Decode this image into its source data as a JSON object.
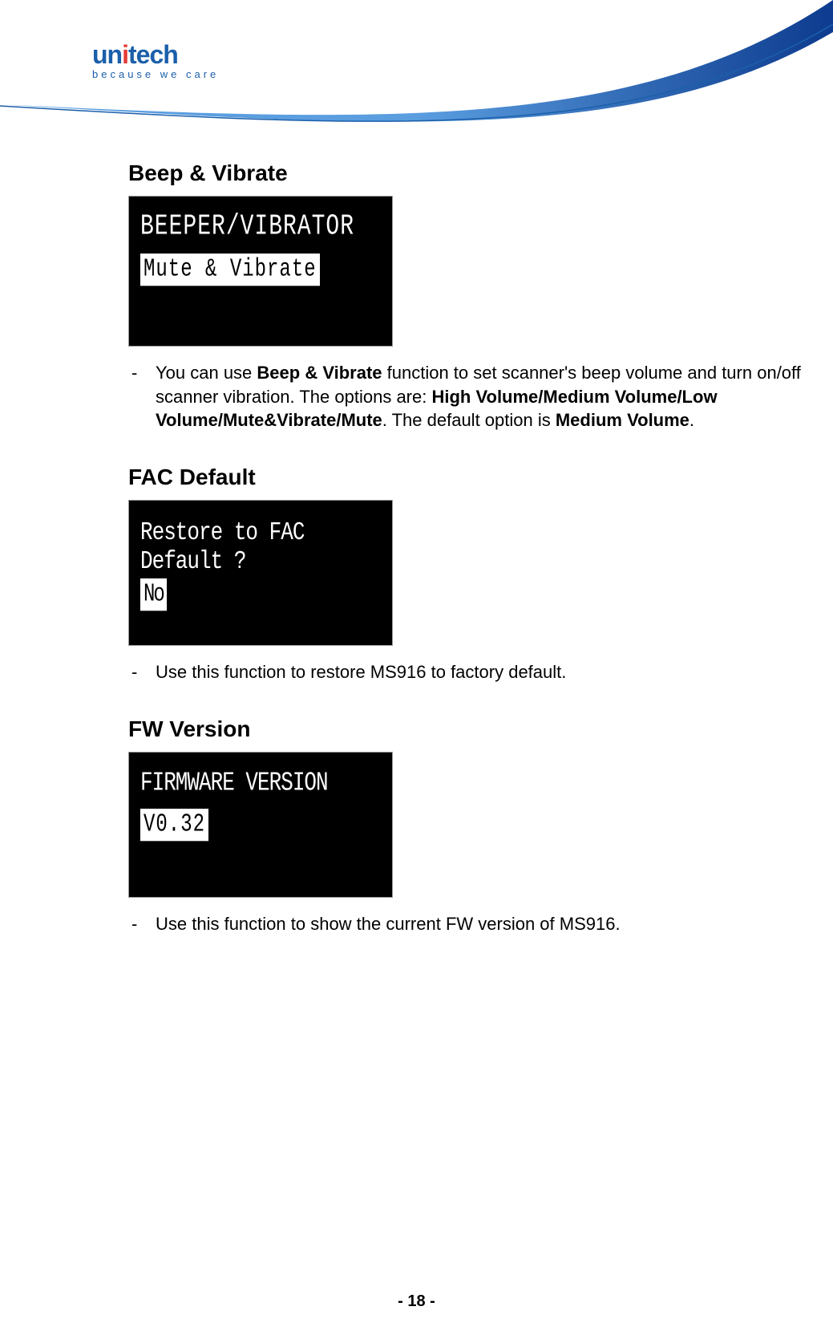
{
  "logo": {
    "brand_pre": "un",
    "brand_i": "i",
    "brand_post": "tech",
    "tagline": "because we care"
  },
  "sections": {
    "beep": {
      "heading": "Beep & Vibrate",
      "screen_title": "BEEPER/VIBRATOR",
      "screen_value": "Mute & Vibrate",
      "desc_pre": "You can use ",
      "desc_b1": "Beep & Vibrate",
      "desc_mid1": " function to set scanner's beep volume and turn on/off scanner vibration. The options are: ",
      "desc_b2": "High Volume/Medium Volume/Low Volume/Mute&Vibrate/Mute",
      "desc_mid2": ". The default option is ",
      "desc_b3": "Medium Volume",
      "desc_post": "."
    },
    "fac": {
      "heading": "FAC Default",
      "screen_line1": "Restore to FAC",
      "screen_line2": "Default ?",
      "screen_value": "No",
      "desc": "Use this function to restore MS916 to factory default."
    },
    "fw": {
      "heading": "FW Version",
      "screen_title": "FIRMWARE VERSION",
      "screen_value": "V0.32",
      "desc": "Use this function to show the current FW version of MS916."
    }
  },
  "footer": {
    "page": "- 18 -"
  }
}
